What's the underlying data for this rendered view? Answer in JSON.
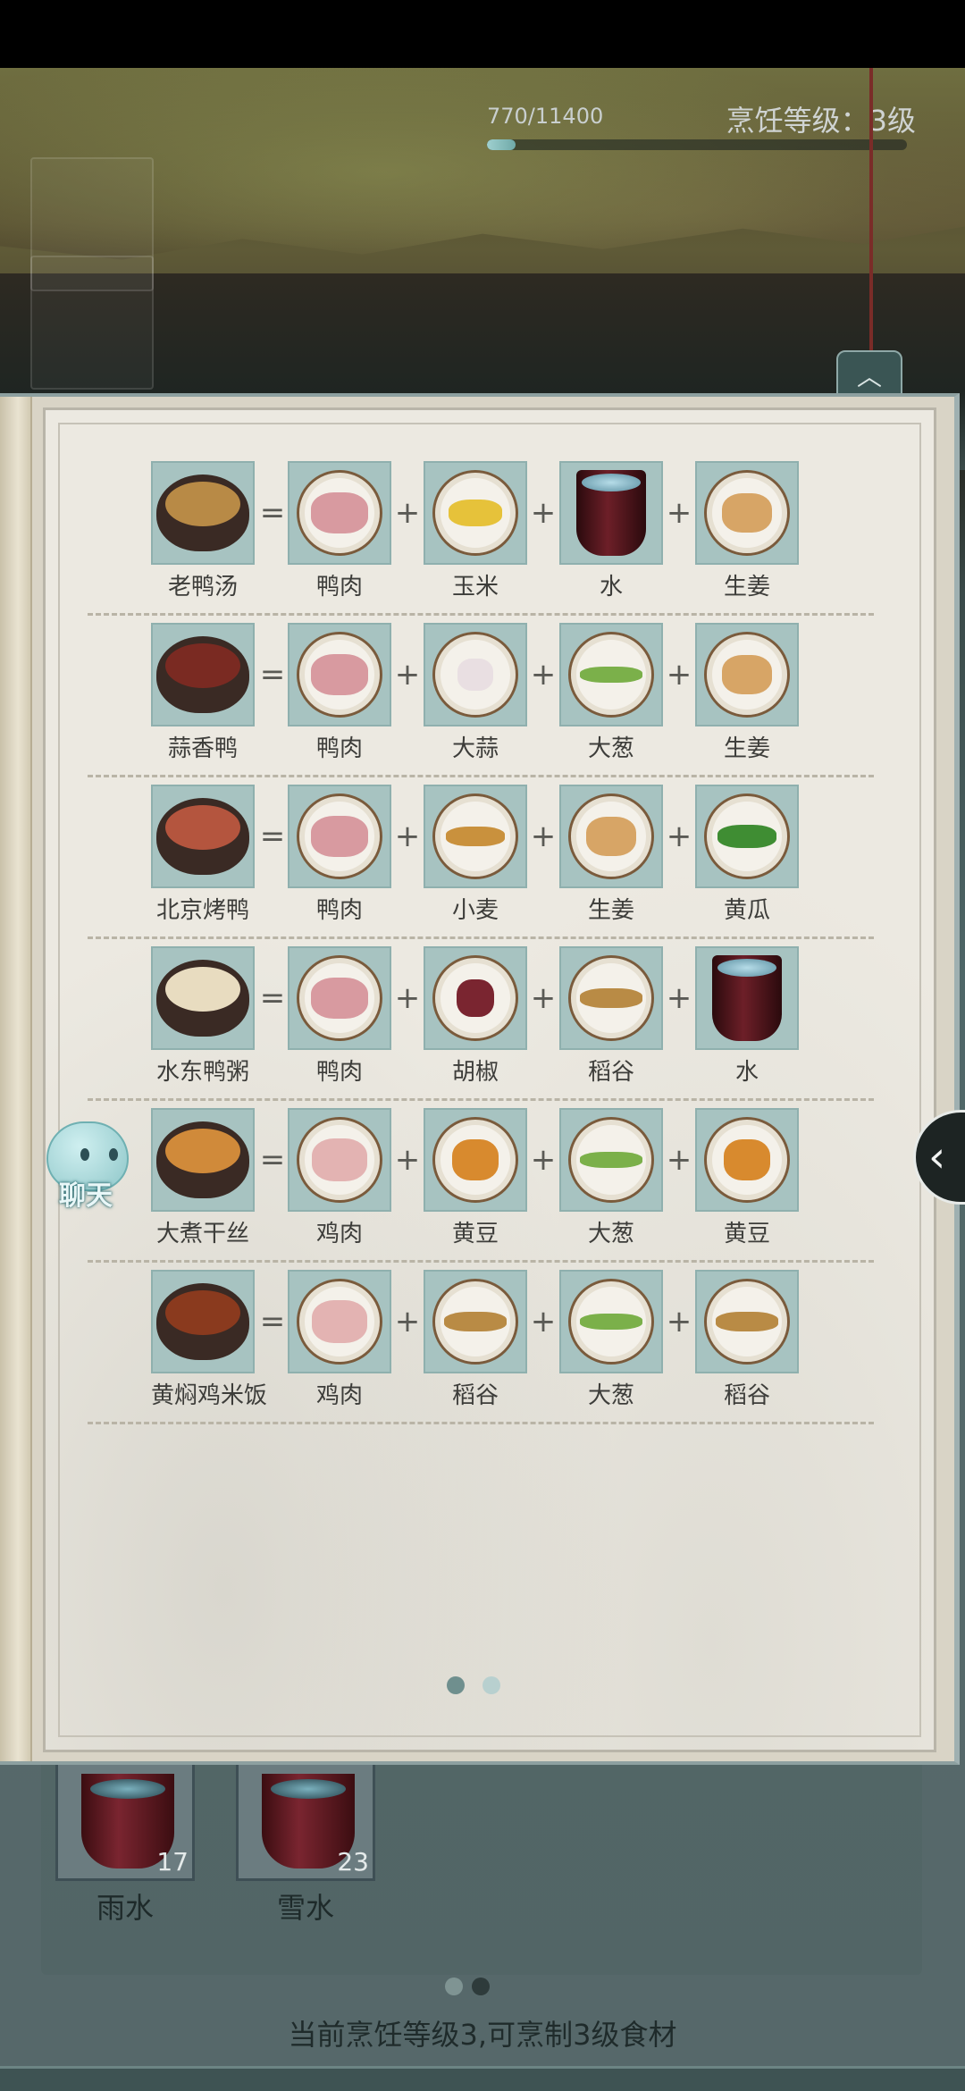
{
  "cooking": {
    "exp_text": "770/11400",
    "exp_progress": 0.0675,
    "level_text": "烹饪等级：3级"
  },
  "recipe_book": {
    "recipes": [
      {
        "dish": "老鸭汤",
        "ingredients": [
          "鸭肉",
          "玉米",
          "水",
          "生姜"
        ]
      },
      {
        "dish": "蒜香鸭",
        "ingredients": [
          "鸭肉",
          "大蒜",
          "大葱",
          "生姜"
        ]
      },
      {
        "dish": "北京烤鸭",
        "ingredients": [
          "鸭肉",
          "小麦",
          "生姜",
          "黄瓜"
        ]
      },
      {
        "dish": "水东鸭粥",
        "ingredients": [
          "鸭肉",
          "胡椒",
          "稻谷",
          "水"
        ]
      },
      {
        "dish": "大煮干丝",
        "ingredients": [
          "鸡肉",
          "黄豆",
          "大葱",
          "黄豆"
        ]
      },
      {
        "dish": "黄焖鸡米饭",
        "ingredients": [
          "鸡肉",
          "稻谷",
          "大葱",
          "稻谷"
        ]
      }
    ],
    "equals_sign": "=",
    "plus_sign": "+",
    "page_indicator": {
      "total": 2,
      "current": 1
    }
  },
  "chat_button": {
    "label": "聊天"
  },
  "side_button": {
    "icon": "chevron-left-icon",
    "glyph": "‹"
  },
  "up_button": {
    "icon": "chevron-up-icon",
    "glyph": "︿"
  },
  "water_slots": [
    {
      "name": "雨水",
      "count": "17"
    },
    {
      "name": "雪水",
      "count": "23"
    }
  ],
  "lower_page_indicator": {
    "total": 2,
    "current": 2
  },
  "bottom_tip": "当前烹饪等级3,可烹制3级食材",
  "colors": {
    "tile_bg": "#a7c3c1",
    "page_bg": "#ece9e1",
    "dot_active": "#6f8f8e",
    "dot_inactive": "#b8d0cf"
  }
}
